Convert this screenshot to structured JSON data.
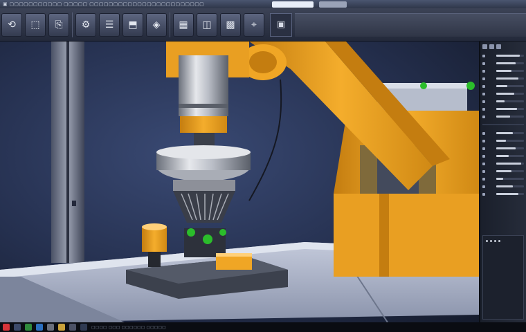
{
  "window": {
    "title_strip": "▣ ▢▢▢▢▢▢▢▢▢▢▢ ▢▢▢▢▢ ▢▢▢▢▢▢▢▢▢▢▢▢▢▢▢▢▢▢▢▢▢▢▢▢"
  },
  "ribbon": {
    "buttons": [
      {
        "name": "undo-button",
        "icon": "⟲"
      },
      {
        "name": "part-button",
        "icon": "⬚"
      },
      {
        "name": "import-button",
        "icon": "⎘"
      },
      {
        "name": "assembly-button",
        "icon": "⚙"
      },
      {
        "name": "fixture-button",
        "icon": "☰"
      },
      {
        "name": "toolpath-button",
        "icon": "⬒"
      },
      {
        "name": "simulate-button",
        "icon": "◈"
      },
      {
        "name": "render-button",
        "icon": "▦"
      },
      {
        "name": "view-button",
        "icon": "◫"
      },
      {
        "name": "grid-button",
        "icon": "▩"
      },
      {
        "name": "measure-button",
        "icon": "⌖"
      }
    ],
    "right_button_icon": "▣"
  },
  "panel": {
    "rows": [
      {
        "label": "",
        "level": 0.85
      },
      {
        "label": "",
        "level": 0.7
      },
      {
        "label": "",
        "level": 0.55
      },
      {
        "label": "",
        "level": 0.8
      },
      {
        "label": "",
        "level": 0.4
      },
      {
        "label": "",
        "level": 0.65
      },
      {
        "label": "",
        "level": 0.3
      },
      {
        "label": "",
        "level": 0.75
      },
      {
        "label": "",
        "level": 0.5
      },
      {
        "label": "",
        "level": 0.6
      },
      {
        "label": "",
        "level": 0.35
      },
      {
        "label": "",
        "level": 0.7
      },
      {
        "label": "",
        "level": 0.45
      },
      {
        "label": "",
        "level": 0.9
      },
      {
        "label": "",
        "level": 0.55
      },
      {
        "label": "",
        "level": 0.25
      },
      {
        "label": "",
        "level": 0.6
      },
      {
        "label": "",
        "level": 0.8
      }
    ]
  },
  "taskbar": {
    "text": "▢▢▢▢ ▢▢▢ ▢▢▢▢▢▢ ▢▢▢▢▢"
  },
  "colors": {
    "robot": "#f0a625",
    "robot_shade": "#c47d10",
    "steel": "#c9ccd3",
    "table": "#aab2c9",
    "viewport_bg": "#2a3554",
    "accent_green": "#2bbd2b"
  }
}
